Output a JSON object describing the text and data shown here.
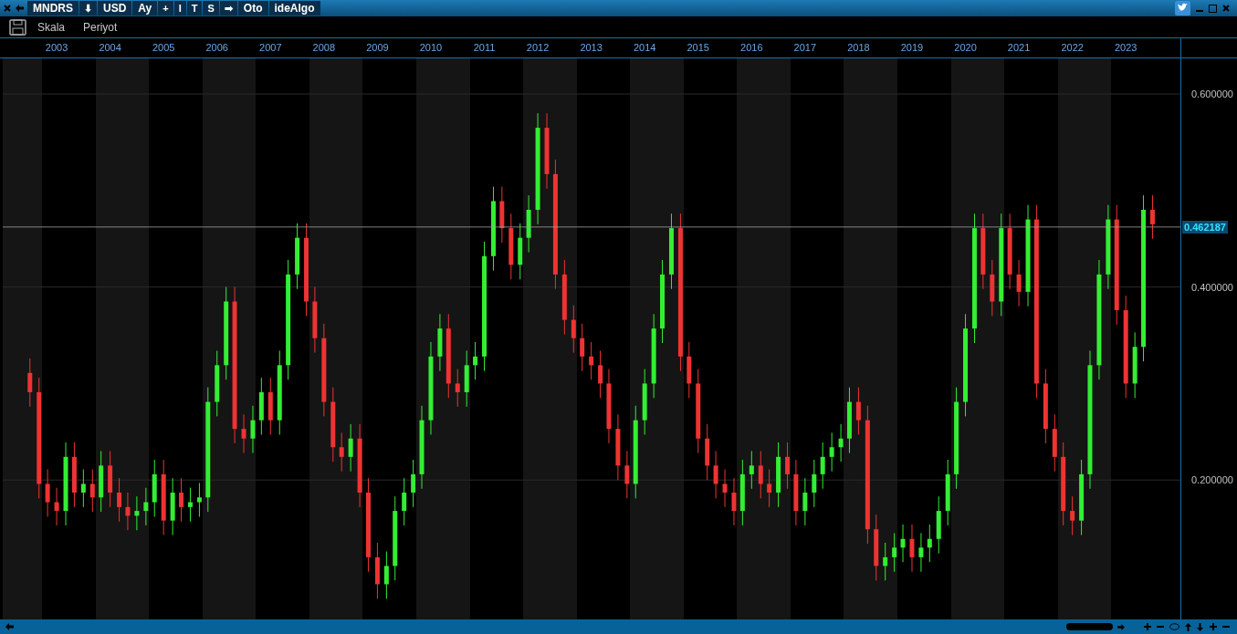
{
  "toolbar": {
    "buttons": [
      {
        "label": "MNDRS",
        "kind": "text"
      },
      {
        "label": "⬇",
        "kind": "glyph"
      },
      {
        "label": "USD",
        "kind": "text"
      },
      {
        "label": "Ay",
        "kind": "text"
      },
      {
        "label": "+",
        "kind": "glyph"
      },
      {
        "label": "I",
        "kind": "glyph"
      },
      {
        "label": "T",
        "kind": "glyph"
      },
      {
        "label": "S",
        "kind": "glyph"
      },
      {
        "label": "➡",
        "kind": "glyph"
      },
      {
        "label": "Oto",
        "kind": "text"
      },
      {
        "label": "ideAlgo",
        "kind": "text"
      }
    ]
  },
  "menu": [
    "Skala",
    "Periyot"
  ],
  "chart_data": {
    "type": "candlestick",
    "grid": true,
    "xlim": [
      2001.94,
      2025.08
    ],
    "ylim": [
      0.0556,
      0.6577
    ],
    "ref_lines": [
      {
        "axis": "y",
        "value": 0.462187,
        "label": "0.462187"
      }
    ],
    "xticks": [
      {
        "value": 2003,
        "label": "2003"
      },
      {
        "value": 2004,
        "label": "2004"
      },
      {
        "value": 2005,
        "label": "2005"
      },
      {
        "value": 2006,
        "label": "2006"
      },
      {
        "value": 2007,
        "label": "2007"
      },
      {
        "value": 2008,
        "label": "2008"
      },
      {
        "value": 2009,
        "label": "2009"
      },
      {
        "value": 2010,
        "label": "2010"
      },
      {
        "value": 2011,
        "label": "2011"
      },
      {
        "value": 2012,
        "label": "2012"
      },
      {
        "value": 2013,
        "label": "2013"
      },
      {
        "value": 2014,
        "label": "2014"
      },
      {
        "value": 2015,
        "label": "2015"
      },
      {
        "value": 2016,
        "label": "2016"
      },
      {
        "value": 2017,
        "label": "2017"
      },
      {
        "value": 2018,
        "label": "2018"
      },
      {
        "value": 2019,
        "label": "2019"
      },
      {
        "value": 2020,
        "label": "2020"
      },
      {
        "value": 2021,
        "label": "2021"
      },
      {
        "value": 2022,
        "label": "2022"
      },
      {
        "value": 2023,
        "label": "2023"
      }
    ],
    "x": [
      2002.5,
      2002.67,
      2002.83,
      2003,
      2003.17,
      2003.33,
      2003.5,
      2003.67,
      2003.83,
      2004,
      2004.17,
      2004.33,
      2004.5,
      2004.67,
      2004.83,
      2005,
      2005.17,
      2005.33,
      2005.5,
      2005.67,
      2005.83,
      2006,
      2006.17,
      2006.33,
      2006.5,
      2006.67,
      2006.83,
      2007,
      2007.17,
      2007.33,
      2007.5,
      2007.67,
      2007.83,
      2008,
      2008.17,
      2008.33,
      2008.5,
      2008.67,
      2008.83,
      2009,
      2009.17,
      2009.33,
      2009.5,
      2009.67,
      2009.83,
      2010,
      2010.17,
      2010.33,
      2010.5,
      2010.67,
      2010.83,
      2011,
      2011.17,
      2011.33,
      2011.5,
      2011.67,
      2011.83,
      2012,
      2012.17,
      2012.33,
      2012.5,
      2012.67,
      2012.83,
      2013,
      2013.17,
      2013.33,
      2013.5,
      2013.67,
      2013.83,
      2014,
      2014.17,
      2014.33,
      2014.5,
      2014.67,
      2014.83,
      2015,
      2015.17,
      2015.33,
      2015.5,
      2015.67,
      2015.83,
      2016,
      2016.17,
      2016.33,
      2016.5,
      2016.67,
      2016.83,
      2017,
      2017.17,
      2017.33,
      2017.5,
      2017.67,
      2017.83,
      2018,
      2018.17,
      2018.33,
      2018.5,
      2018.67,
      2018.83,
      2019,
      2019.17,
      2019.33,
      2019.5,
      2019.67,
      2019.83,
      2020,
      2020.17,
      2020.33,
      2020.5,
      2020.67,
      2020.83,
      2021,
      2021.17,
      2021.33,
      2021.5,
      2021.67,
      2021.83,
      2022,
      2022.17,
      2022.33,
      2022.5,
      2022.67,
      2022.83,
      2023,
      2023.17,
      2023.33,
      2023.5
    ],
    "yticks": [
      {
        "value": 0.6,
        "label": "0.600000"
      },
      {
        "value": 0.4,
        "label": "0.400000"
      },
      {
        "value": 0.2,
        "label": "0.200000"
      }
    ],
    "ohlc": [
      [
        0.311,
        0.326,
        0.276,
        0.291
      ],
      [
        0.291,
        0.306,
        0.181,
        0.196
      ],
      [
        0.196,
        0.211,
        0.162,
        0.177
      ],
      [
        0.177,
        0.192,
        0.153,
        0.168
      ],
      [
        0.168,
        0.239,
        0.153,
        0.224
      ],
      [
        0.224,
        0.239,
        0.172,
        0.187
      ],
      [
        0.187,
        0.211,
        0.172,
        0.196
      ],
      [
        0.196,
        0.211,
        0.167,
        0.182
      ],
      [
        0.182,
        0.23,
        0.167,
        0.215
      ],
      [
        0.215,
        0.23,
        0.172,
        0.187
      ],
      [
        0.187,
        0.202,
        0.157,
        0.172
      ],
      [
        0.172,
        0.187,
        0.148,
        0.163
      ],
      [
        0.163,
        0.183,
        0.148,
        0.168
      ],
      [
        0.168,
        0.192,
        0.153,
        0.177
      ],
      [
        0.177,
        0.221,
        0.162,
        0.206
      ],
      [
        0.206,
        0.221,
        0.143,
        0.158
      ],
      [
        0.158,
        0.202,
        0.143,
        0.187
      ],
      [
        0.187,
        0.202,
        0.157,
        0.172
      ],
      [
        0.172,
        0.192,
        0.157,
        0.177
      ],
      [
        0.177,
        0.197,
        0.162,
        0.182
      ],
      [
        0.182,
        0.296,
        0.167,
        0.281
      ],
      [
        0.281,
        0.334,
        0.266,
        0.319
      ],
      [
        0.319,
        0.4,
        0.304,
        0.385
      ],
      [
        0.385,
        0.4,
        0.238,
        0.253
      ],
      [
        0.253,
        0.268,
        0.228,
        0.243
      ],
      [
        0.243,
        0.277,
        0.228,
        0.262
      ],
      [
        0.262,
        0.306,
        0.247,
        0.291
      ],
      [
        0.291,
        0.306,
        0.247,
        0.262
      ],
      [
        0.262,
        0.334,
        0.247,
        0.319
      ],
      [
        0.319,
        0.428,
        0.304,
        0.413
      ],
      [
        0.413,
        0.466,
        0.398,
        0.451
      ],
      [
        0.451,
        0.466,
        0.37,
        0.385
      ],
      [
        0.385,
        0.4,
        0.332,
        0.347
      ],
      [
        0.347,
        0.362,
        0.266,
        0.281
      ],
      [
        0.281,
        0.296,
        0.219,
        0.234
      ],
      [
        0.234,
        0.249,
        0.209,
        0.224
      ],
      [
        0.224,
        0.258,
        0.209,
        0.243
      ],
      [
        0.243,
        0.258,
        0.172,
        0.187
      ],
      [
        0.187,
        0.202,
        0.105,
        0.12
      ],
      [
        0.12,
        0.135,
        0.077,
        0.092
      ],
      [
        0.092,
        0.126,
        0.077,
        0.111
      ],
      [
        0.111,
        0.183,
        0.096,
        0.168
      ],
      [
        0.168,
        0.202,
        0.153,
        0.187
      ],
      [
        0.187,
        0.221,
        0.172,
        0.206
      ],
      [
        0.206,
        0.277,
        0.191,
        0.262
      ],
      [
        0.262,
        0.343,
        0.247,
        0.328
      ],
      [
        0.328,
        0.372,
        0.313,
        0.357
      ],
      [
        0.357,
        0.372,
        0.285,
        0.3
      ],
      [
        0.3,
        0.315,
        0.276,
        0.291
      ],
      [
        0.291,
        0.334,
        0.276,
        0.319
      ],
      [
        0.319,
        0.343,
        0.304,
        0.328
      ],
      [
        0.328,
        0.447,
        0.313,
        0.432
      ],
      [
        0.432,
        0.504,
        0.417,
        0.489
      ],
      [
        0.489,
        0.504,
        0.446,
        0.461
      ],
      [
        0.461,
        0.476,
        0.408,
        0.423
      ],
      [
        0.423,
        0.466,
        0.408,
        0.451
      ],
      [
        0.451,
        0.495,
        0.436,
        0.48
      ],
      [
        0.48,
        0.58,
        0.465,
        0.565
      ],
      [
        0.565,
        0.58,
        0.502,
        0.517
      ],
      [
        0.517,
        0.532,
        0.398,
        0.413
      ],
      [
        0.413,
        0.428,
        0.351,
        0.366
      ],
      [
        0.366,
        0.381,
        0.332,
        0.347
      ],
      [
        0.347,
        0.362,
        0.313,
        0.328
      ],
      [
        0.328,
        0.343,
        0.304,
        0.319
      ],
      [
        0.319,
        0.334,
        0.285,
        0.3
      ],
      [
        0.3,
        0.315,
        0.238,
        0.253
      ],
      [
        0.253,
        0.268,
        0.2,
        0.215
      ],
      [
        0.215,
        0.23,
        0.181,
        0.196
      ],
      [
        0.196,
        0.277,
        0.181,
        0.262
      ],
      [
        0.262,
        0.315,
        0.247,
        0.3
      ],
      [
        0.3,
        0.372,
        0.285,
        0.357
      ],
      [
        0.357,
        0.428,
        0.342,
        0.413
      ],
      [
        0.413,
        0.476,
        0.398,
        0.461
      ],
      [
        0.461,
        0.476,
        0.313,
        0.328
      ],
      [
        0.328,
        0.343,
        0.285,
        0.3
      ],
      [
        0.3,
        0.315,
        0.228,
        0.243
      ],
      [
        0.243,
        0.258,
        0.2,
        0.215
      ],
      [
        0.215,
        0.23,
        0.181,
        0.196
      ],
      [
        0.196,
        0.211,
        0.172,
        0.187
      ],
      [
        0.187,
        0.202,
        0.153,
        0.168
      ],
      [
        0.168,
        0.221,
        0.153,
        0.206
      ],
      [
        0.206,
        0.23,
        0.191,
        0.215
      ],
      [
        0.215,
        0.23,
        0.181,
        0.196
      ],
      [
        0.196,
        0.211,
        0.172,
        0.187
      ],
      [
        0.187,
        0.239,
        0.172,
        0.224
      ],
      [
        0.224,
        0.239,
        0.191,
        0.206
      ],
      [
        0.206,
        0.221,
        0.153,
        0.168
      ],
      [
        0.168,
        0.202,
        0.153,
        0.187
      ],
      [
        0.187,
        0.221,
        0.172,
        0.206
      ],
      [
        0.206,
        0.239,
        0.191,
        0.224
      ],
      [
        0.224,
        0.249,
        0.209,
        0.234
      ],
      [
        0.234,
        0.258,
        0.219,
        0.243
      ],
      [
        0.243,
        0.296,
        0.228,
        0.281
      ],
      [
        0.281,
        0.296,
        0.247,
        0.262
      ],
      [
        0.262,
        0.277,
        0.134,
        0.149
      ],
      [
        0.149,
        0.164,
        0.096,
        0.111
      ],
      [
        0.111,
        0.135,
        0.096,
        0.12
      ],
      [
        0.12,
        0.145,
        0.105,
        0.13
      ],
      [
        0.13,
        0.154,
        0.115,
        0.139
      ],
      [
        0.139,
        0.154,
        0.105,
        0.12
      ],
      [
        0.12,
        0.145,
        0.105,
        0.13
      ],
      [
        0.13,
        0.154,
        0.115,
        0.139
      ],
      [
        0.139,
        0.183,
        0.124,
        0.168
      ],
      [
        0.168,
        0.221,
        0.153,
        0.206
      ],
      [
        0.206,
        0.296,
        0.191,
        0.281
      ],
      [
        0.281,
        0.372,
        0.266,
        0.357
      ],
      [
        0.357,
        0.476,
        0.342,
        0.461
      ],
      [
        0.461,
        0.476,
        0.398,
        0.413
      ],
      [
        0.413,
        0.428,
        0.37,
        0.385
      ],
      [
        0.385,
        0.476,
        0.37,
        0.461
      ],
      [
        0.461,
        0.476,
        0.398,
        0.413
      ],
      [
        0.413,
        0.428,
        0.38,
        0.395
      ],
      [
        0.395,
        0.485,
        0.38,
        0.47
      ],
      [
        0.47,
        0.485,
        0.285,
        0.3
      ],
      [
        0.3,
        0.315,
        0.238,
        0.253
      ],
      [
        0.253,
        0.268,
        0.209,
        0.224
      ],
      [
        0.224,
        0.239,
        0.153,
        0.168
      ],
      [
        0.168,
        0.183,
        0.143,
        0.158
      ],
      [
        0.158,
        0.221,
        0.143,
        0.206
      ],
      [
        0.206,
        0.334,
        0.191,
        0.319
      ],
      [
        0.319,
        0.428,
        0.304,
        0.413
      ],
      [
        0.413,
        0.485,
        0.398,
        0.47
      ],
      [
        0.47,
        0.485,
        0.361,
        0.376
      ],
      [
        0.376,
        0.391,
        0.285,
        0.3
      ],
      [
        0.3,
        0.353,
        0.285,
        0.338
      ],
      [
        0.338,
        0.495,
        0.323,
        0.48
      ],
      [
        0.48,
        0.495,
        0.45,
        0.465
      ]
    ]
  }
}
